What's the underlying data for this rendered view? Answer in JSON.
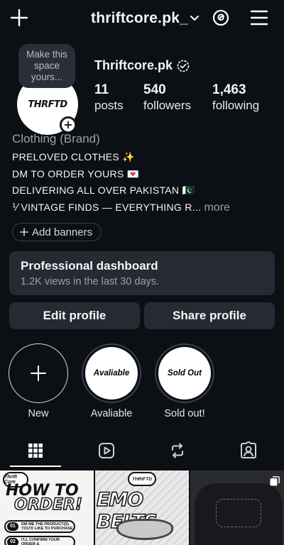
{
  "header": {
    "username": "thriftcore.pk_",
    "icons": [
      "plus-icon",
      "chevron-down-icon",
      "threads-icon",
      "menu-icon"
    ]
  },
  "profile": {
    "note": "Make this space yours...",
    "avatar_text": "THRFTD",
    "name": "Thriftcore.pk",
    "stats": [
      {
        "value": "11",
        "label": "posts"
      },
      {
        "value": "540",
        "label": "followers"
      },
      {
        "value": "1,463",
        "label": "following"
      }
    ],
    "category": "Clothing (Brand)",
    "bio_lines": [
      "PRELOVED CLOTHES ✨",
      "DM TO ORDER YOURS 💌",
      "DELIVERING ALL OVER PAKISTAN 🇵🇰",
      "⅟ VINTAGE FINDS — EVERYTHING R..."
    ],
    "more_label": "more",
    "add_banners": "Add banners"
  },
  "dashboard": {
    "title": "Professional dashboard",
    "subtitle": "1.2K views in the last 30 days."
  },
  "buttons": {
    "edit": "Edit profile",
    "share": "Share profile"
  },
  "highlights": [
    {
      "label": "New",
      "cover": ""
    },
    {
      "label": "Avaliable",
      "cover": "Avaliable"
    },
    {
      "label": "Sold out!",
      "cover": "Sold Out"
    }
  ],
  "tabs": [
    "grid-icon",
    "reels-icon",
    "reposts-icon",
    "tagged-icon"
  ],
  "posts": [
    {
      "pill": "Thrift Core",
      "line1": "HOW TO",
      "line2": "ORDER!",
      "steps": [
        {
          "n": "01",
          "text": "DM ME THE PRODUCT(S) YOU'D LIKE TO PURCHASE"
        },
        {
          "n": "02",
          "text": "I'LL CONFIRM YOUR ORDER &"
        }
      ]
    },
    {
      "pill": "THRIFTD",
      "title": "EMO BELTS"
    },
    {
      "title": ""
    }
  ],
  "colors": {
    "background": "#0c0f14",
    "surface": "#262a32",
    "muted_text": "#9ba0a8"
  }
}
